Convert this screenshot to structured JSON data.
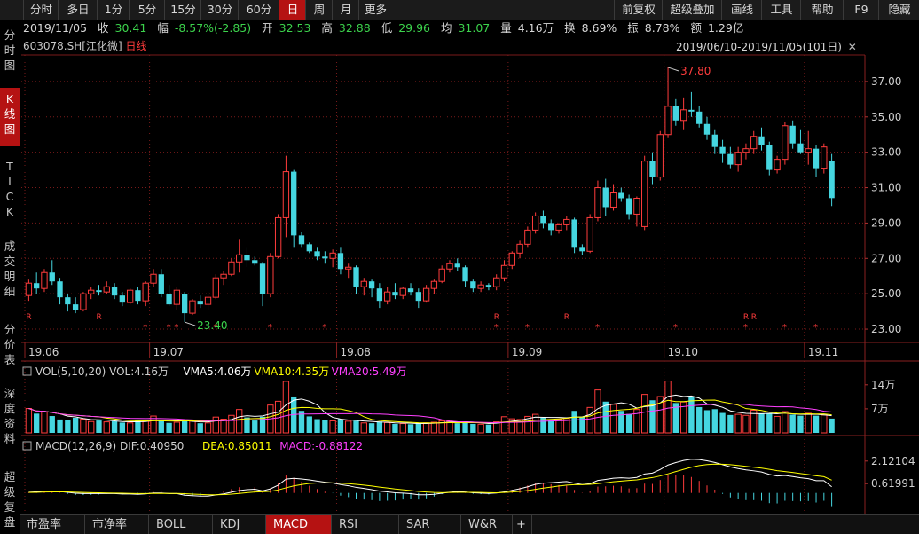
{
  "toolbar": {
    "left": [
      "分时",
      "多日",
      "1分",
      "5分",
      "15分",
      "30分",
      "60分",
      "日",
      "周",
      "月",
      "更多"
    ],
    "active": "日",
    "right": [
      "前复权",
      "超级叠加",
      "画线",
      "工具",
      "帮助",
      "F9",
      "隐藏"
    ]
  },
  "sidebar": [
    "分时图",
    "K线图",
    "TICK",
    "成交明细",
    "分价表",
    "深度资料",
    "超级复盘"
  ],
  "sidebar_active": "K线图",
  "quote": {
    "date": "2019/11/05",
    "close_label": "收",
    "close": "30.41",
    "change_label": "幅",
    "change": "-8.57%(-2.85)",
    "open_label": "开",
    "open": "32.53",
    "high_label": "高",
    "high": "32.88",
    "low_label": "低",
    "low": "29.96",
    "avg_label": "均",
    "avg": "31.07",
    "vol_label": "量",
    "vol": "4.16万",
    "turnover_label": "换",
    "turnover": "8.69%",
    "amplitude_label": "振",
    "amplitude": "8.78%",
    "amount_label": "额",
    "amount": "1.29亿"
  },
  "stock": {
    "code": "603078.SH",
    "name": "[江化微]",
    "period": "日线"
  },
  "range_text": "2019/06/10-2019/11/05(101日)",
  "colors": {
    "up": "#ff3c3c",
    "down": "#45d6e0",
    "grid": "#7a1a1a",
    "bg": "#000000",
    "vma5": "#ffffff",
    "vma10": "#ffff00",
    "vma20": "#ff40ff"
  },
  "chart_data": [
    {
      "type": "candlestick",
      "ylim": [
        22.3,
        38.5
      ],
      "yticks": [
        "37.00",
        "35.00",
        "33.00",
        "31.00",
        "29.00",
        "27.00",
        "25.00",
        "23.00"
      ],
      "ytick_values": [
        37,
        35,
        33,
        31,
        29,
        27,
        25,
        23
      ],
      "xticks": [
        "19.06",
        "19.07",
        "19.08",
        "19.09",
        "19.10",
        "19.11"
      ],
      "xtick_index": [
        0,
        16,
        40,
        62,
        82,
        100
      ],
      "annotations": [
        {
          "text": "37.80",
          "index": 82,
          "value": 37.8,
          "color": "#ff3c3c"
        },
        {
          "text": "23.40",
          "index": 20,
          "value": 23.4,
          "color": "#3cd34c"
        }
      ],
      "markers_R": [
        0,
        9,
        60,
        69,
        92,
        93
      ],
      "markers_star": [
        15,
        18,
        19,
        24,
        31,
        38,
        60,
        64,
        73,
        83,
        92,
        97,
        101
      ],
      "ohlc": [
        [
          24.9,
          25.8,
          24.6,
          25.6
        ],
        [
          25.6,
          26.2,
          25.0,
          25.3
        ],
        [
          25.3,
          26.4,
          25.1,
          26.2
        ],
        [
          26.2,
          26.9,
          25.5,
          25.7
        ],
        [
          25.7,
          25.9,
          24.4,
          24.8
        ],
        [
          24.8,
          25.0,
          24.0,
          24.4
        ],
        [
          24.4,
          24.8,
          23.9,
          24.1
        ],
        [
          24.1,
          25.1,
          24.0,
          25.0
        ],
        [
          25.0,
          25.4,
          24.7,
          25.2
        ],
        [
          25.2,
          25.5,
          24.9,
          25.1
        ],
        [
          25.1,
          25.7,
          25.0,
          25.4
        ],
        [
          25.4,
          25.6,
          24.7,
          24.9
        ],
        [
          24.9,
          25.1,
          24.3,
          24.5
        ],
        [
          24.5,
          25.3,
          24.4,
          25.2
        ],
        [
          25.2,
          25.4,
          24.4,
          24.6
        ],
        [
          24.6,
          25.7,
          24.3,
          25.6
        ],
        [
          25.6,
          26.4,
          25.4,
          26.1
        ],
        [
          26.1,
          26.4,
          24.8,
          25.0
        ],
        [
          25.0,
          25.5,
          24.3,
          24.4
        ],
        [
          24.4,
          25.4,
          24.1,
          25.2
        ],
        [
          25.0,
          25.1,
          23.4,
          23.9
        ],
        [
          23.9,
          24.7,
          23.8,
          24.6
        ],
        [
          24.6,
          24.9,
          24.2,
          24.4
        ],
        [
          24.4,
          25.1,
          24.1,
          24.8
        ],
        [
          24.8,
          26.1,
          24.7,
          25.9
        ],
        [
          25.9,
          26.3,
          25.5,
          26.1
        ],
        [
          26.1,
          27.0,
          26.0,
          26.8
        ],
        [
          26.8,
          28.1,
          26.2,
          27.2
        ],
        [
          27.2,
          27.6,
          26.5,
          26.9
        ],
        [
          26.9,
          27.1,
          26.6,
          26.7
        ],
        [
          26.7,
          26.8,
          24.3,
          25.0
        ],
        [
          25.0,
          27.3,
          24.8,
          27.1
        ],
        [
          27.1,
          29.5,
          27.0,
          29.3
        ],
        [
          29.3,
          32.8,
          28.2,
          31.9
        ],
        [
          31.9,
          32.0,
          27.6,
          28.3
        ],
        [
          28.3,
          28.5,
          27.6,
          27.8
        ],
        [
          27.8,
          27.9,
          27.3,
          27.4
        ],
        [
          27.4,
          27.6,
          26.9,
          27.1
        ],
        [
          27.1,
          27.4,
          26.7,
          27.0
        ],
        [
          27.0,
          27.5,
          26.5,
          27.3
        ],
        [
          27.3,
          27.6,
          26.1,
          26.4
        ],
        [
          26.4,
          26.7,
          25.9,
          26.5
        ],
        [
          26.5,
          26.6,
          25.0,
          25.4
        ],
        [
          25.4,
          25.9,
          24.9,
          25.7
        ],
        [
          25.7,
          25.8,
          24.8,
          25.3
        ],
        [
          25.3,
          25.6,
          24.2,
          24.6
        ],
        [
          24.6,
          25.4,
          24.4,
          25.1
        ],
        [
          25.1,
          25.6,
          24.7,
          24.9
        ],
        [
          24.9,
          25.4,
          24.7,
          25.3
        ],
        [
          25.3,
          25.6,
          24.9,
          25.1
        ],
        [
          25.1,
          25.3,
          24.2,
          24.6
        ],
        [
          24.6,
          25.5,
          24.5,
          25.3
        ],
        [
          25.3,
          25.8,
          25.0,
          25.7
        ],
        [
          25.7,
          26.6,
          25.6,
          26.4
        ],
        [
          26.4,
          26.9,
          26.2,
          26.7
        ],
        [
          26.7,
          27.0,
          26.3,
          26.5
        ],
        [
          26.5,
          26.6,
          25.4,
          25.7
        ],
        [
          25.7,
          25.8,
          25.1,
          25.3
        ],
        [
          25.3,
          25.7,
          25.1,
          25.5
        ],
        [
          25.5,
          25.6,
          25.2,
          25.4
        ],
        [
          25.4,
          26.1,
          25.2,
          25.9
        ],
        [
          25.9,
          26.9,
          25.7,
          26.6
        ],
        [
          26.6,
          27.4,
          26.4,
          27.3
        ],
        [
          27.3,
          28.0,
          27.0,
          27.8
        ],
        [
          27.8,
          28.8,
          27.6,
          28.6
        ],
        [
          28.6,
          29.6,
          28.4,
          29.4
        ],
        [
          29.4,
          29.7,
          28.7,
          29.0
        ],
        [
          29.0,
          29.2,
          28.3,
          28.6
        ],
        [
          28.6,
          29.0,
          28.4,
          28.9
        ],
        [
          28.9,
          29.4,
          28.6,
          29.2
        ],
        [
          29.2,
          29.3,
          27.3,
          27.6
        ],
        [
          27.6,
          27.8,
          27.2,
          27.4
        ],
        [
          27.4,
          29.5,
          27.3,
          29.3
        ],
        [
          29.3,
          31.4,
          29.1,
          31.0
        ],
        [
          31.0,
          31.5,
          29.4,
          29.9
        ],
        [
          29.9,
          31.2,
          29.7,
          30.7
        ],
        [
          30.7,
          31.0,
          30.2,
          30.4
        ],
        [
          30.4,
          30.6,
          29.2,
          29.5
        ],
        [
          29.5,
          30.5,
          28.8,
          30.4
        ],
        [
          28.8,
          32.8,
          28.6,
          32.5
        ],
        [
          32.5,
          33.0,
          31.2,
          31.6
        ],
        [
          31.6,
          34.2,
          31.4,
          34.0
        ],
        [
          34.0,
          37.8,
          33.8,
          35.6
        ],
        [
          35.6,
          36.0,
          34.5,
          34.8
        ],
        [
          34.8,
          36.1,
          34.3,
          35.4
        ],
        [
          35.4,
          36.4,
          35.0,
          35.3
        ],
        [
          35.3,
          35.6,
          34.4,
          34.6
        ],
        [
          34.6,
          35.0,
          33.7,
          34.0
        ],
        [
          34.0,
          34.3,
          32.9,
          33.3
        ],
        [
          33.3,
          33.7,
          32.4,
          32.9
        ],
        [
          32.9,
          33.3,
          32.1,
          32.3
        ],
        [
          32.3,
          33.3,
          31.9,
          33.0
        ],
        [
          33.0,
          33.5,
          32.6,
          33.2
        ],
        [
          33.2,
          34.2,
          32.9,
          33.9
        ],
        [
          33.9,
          34.4,
          33.1,
          33.4
        ],
        [
          33.4,
          33.6,
          31.7,
          32.0
        ],
        [
          32.0,
          32.8,
          31.8,
          32.6
        ],
        [
          32.6,
          34.7,
          32.3,
          34.5
        ],
        [
          34.5,
          34.8,
          33.2,
          33.5
        ],
        [
          33.5,
          34.3,
          32.9,
          33.0
        ],
        [
          33.0,
          34.2,
          32.3,
          33.2
        ],
        [
          33.2,
          33.4,
          31.6,
          32.1
        ],
        [
          32.1,
          33.5,
          31.8,
          33.3
        ],
        [
          32.5,
          32.9,
          29.96,
          30.41
        ]
      ]
    },
    {
      "type": "bar",
      "title": "VOL(5,10,20)",
      "labels": {
        "vol": "VOL:4.16万",
        "vma5": "VMA5:4.06万",
        "vma10": "VMA10:4.35万",
        "vma20": "VMA20:5.49万"
      },
      "yticks": [
        "14万",
        "7万"
      ],
      "ytick_values": [
        14,
        7
      ],
      "ylim": [
        0,
        15.5
      ],
      "unit": "万",
      "values": [
        7.1,
        5.6,
        6.2,
        4.9,
        3.9,
        3.8,
        4.4,
        4.0,
        3.3,
        3.6,
        3.2,
        3.4,
        3.0,
        2.9,
        3.7,
        3.5,
        4.9,
        3.6,
        2.9,
        3.1,
        3.8,
        3.4,
        2.8,
        2.9,
        4.6,
        4.0,
        5.1,
        6.8,
        4.5,
        3.6,
        4.7,
        8.1,
        9.2,
        15.0,
        10.6,
        6.4,
        4.8,
        4.0,
        3.8,
        3.5,
        4.0,
        3.4,
        3.5,
        2.9,
        2.8,
        3.3,
        3.0,
        2.6,
        2.7,
        2.5,
        2.8,
        2.9,
        3.1,
        3.5,
        3.4,
        2.8,
        3.3,
        2.6,
        2.5,
        2.4,
        3.2,
        4.7,
        4.1,
        3.9,
        4.8,
        5.4,
        4.4,
        4.0,
        3.9,
        4.2,
        6.4,
        4.7,
        7.4,
        12.5,
        9.1,
        8.3,
        6.4,
        5.5,
        6.8,
        11.2,
        9.5,
        10.6,
        15.1,
        8.7,
        9.0,
        10.4,
        7.5,
        6.6,
        6.9,
        5.8,
        5.2,
        5.4,
        5.1,
        6.6,
        5.6,
        5.7,
        4.8,
        6.2,
        5.3,
        5.0,
        5.7,
        5.0,
        5.2,
        4.16
      ]
    },
    {
      "type": "bar",
      "title": "MACD(12,26,9)",
      "labels": {
        "dif": "DIF:0.40950",
        "dea": "DEA:0.85011",
        "macd": "MACD:-0.88122"
      },
      "yticks": [
        "2.12104",
        "0.61991"
      ],
      "ytick_values": [
        2.12104,
        0.61991
      ],
      "ylim": [
        -1.2,
        2.7
      ],
      "dif": [
        0.05,
        0.08,
        0.12,
        0.13,
        0.09,
        0.04,
        -0.02,
        -0.04,
        -0.04,
        -0.04,
        -0.03,
        -0.04,
        -0.07,
        -0.07,
        -0.09,
        -0.06,
        0.0,
        0.0,
        -0.04,
        -0.04,
        -0.15,
        -0.18,
        -0.21,
        -0.21,
        -0.13,
        -0.06,
        0.05,
        0.16,
        0.22,
        0.25,
        0.14,
        0.27,
        0.52,
        0.92,
        0.97,
        0.93,
        0.87,
        0.79,
        0.71,
        0.66,
        0.56,
        0.48,
        0.37,
        0.3,
        0.22,
        0.12,
        0.07,
        0.01,
        -0.01,
        -0.05,
        -0.12,
        -0.12,
        -0.09,
        -0.02,
        0.05,
        0.09,
        0.06,
        0.01,
        -0.01,
        -0.03,
        0.0,
        0.07,
        0.17,
        0.28,
        0.41,
        0.57,
        0.65,
        0.68,
        0.72,
        0.76,
        0.65,
        0.56,
        0.62,
        0.83,
        0.9,
        0.98,
        1.01,
        0.98,
        1.03,
        1.26,
        1.32,
        1.56,
        1.86,
        2.02,
        2.16,
        2.24,
        2.22,
        2.14,
        2.03,
        1.88,
        1.73,
        1.62,
        1.53,
        1.47,
        1.39,
        1.23,
        1.13,
        1.16,
        1.09,
        1.01,
        0.95,
        0.82,
        0.82,
        0.41
      ],
      "dea": [
        0.03,
        0.04,
        0.06,
        0.07,
        0.08,
        0.07,
        0.05,
        0.03,
        0.02,
        0.01,
        0.0,
        -0.01,
        -0.02,
        -0.03,
        -0.04,
        -0.04,
        -0.03,
        -0.03,
        -0.03,
        -0.03,
        -0.05,
        -0.08,
        -0.1,
        -0.12,
        -0.12,
        -0.11,
        -0.08,
        -0.03,
        0.02,
        0.06,
        0.08,
        0.11,
        0.2,
        0.34,
        0.47,
        0.56,
        0.63,
        0.66,
        0.67,
        0.67,
        0.65,
        0.62,
        0.57,
        0.52,
        0.46,
        0.39,
        0.33,
        0.26,
        0.21,
        0.16,
        0.1,
        0.06,
        0.03,
        0.02,
        0.03,
        0.04,
        0.04,
        0.04,
        0.03,
        0.02,
        0.01,
        0.03,
        0.06,
        0.1,
        0.16,
        0.24,
        0.32,
        0.39,
        0.46,
        0.52,
        0.55,
        0.55,
        0.57,
        0.62,
        0.68,
        0.74,
        0.79,
        0.83,
        0.87,
        0.95,
        1.02,
        1.13,
        1.27,
        1.42,
        1.57,
        1.71,
        1.82,
        1.89,
        1.92,
        1.91,
        1.88,
        1.83,
        1.77,
        1.71,
        1.65,
        1.57,
        1.48,
        1.42,
        1.36,
        1.29,
        1.22,
        1.14,
        1.08,
        0.85
      ],
      "macd": [
        0.04,
        0.08,
        0.12,
        0.12,
        0.02,
        -0.06,
        -0.14,
        -0.14,
        -0.12,
        -0.1,
        -0.06,
        -0.06,
        -0.1,
        -0.08,
        -0.1,
        -0.04,
        0.06,
        0.06,
        -0.02,
        -0.02,
        -0.2,
        -0.2,
        -0.22,
        -0.18,
        -0.02,
        0.1,
        0.26,
        0.38,
        0.4,
        0.38,
        0.12,
        0.32,
        0.64,
        1.16,
        1.0,
        0.74,
        0.48,
        0.26,
        0.08,
        -0.02,
        -0.18,
        -0.28,
        -0.4,
        -0.44,
        -0.48,
        -0.54,
        -0.52,
        -0.5,
        -0.44,
        -0.42,
        -0.44,
        -0.36,
        -0.24,
        -0.08,
        0.04,
        0.1,
        0.04,
        -0.06,
        -0.08,
        -0.1,
        -0.02,
        0.08,
        0.22,
        0.36,
        0.5,
        0.66,
        0.66,
        0.58,
        0.52,
        0.48,
        0.2,
        0.02,
        0.1,
        0.42,
        0.44,
        0.48,
        0.44,
        0.3,
        0.32,
        0.62,
        0.6,
        0.86,
        1.18,
        1.2,
        1.18,
        1.06,
        0.8,
        0.5,
        0.22,
        -0.06,
        -0.3,
        -0.42,
        -0.48,
        -0.48,
        -0.52,
        -0.68,
        -0.7,
        -0.52,
        -0.54,
        -0.56,
        -0.54,
        -0.64,
        -0.52,
        -0.88
      ]
    }
  ],
  "tabs": [
    "市盈率",
    "市净率",
    "BOLL",
    "KDJ",
    "MACD",
    "RSI",
    "SAR",
    "W&R"
  ],
  "tab_active": "MACD",
  "tab_add": "+"
}
